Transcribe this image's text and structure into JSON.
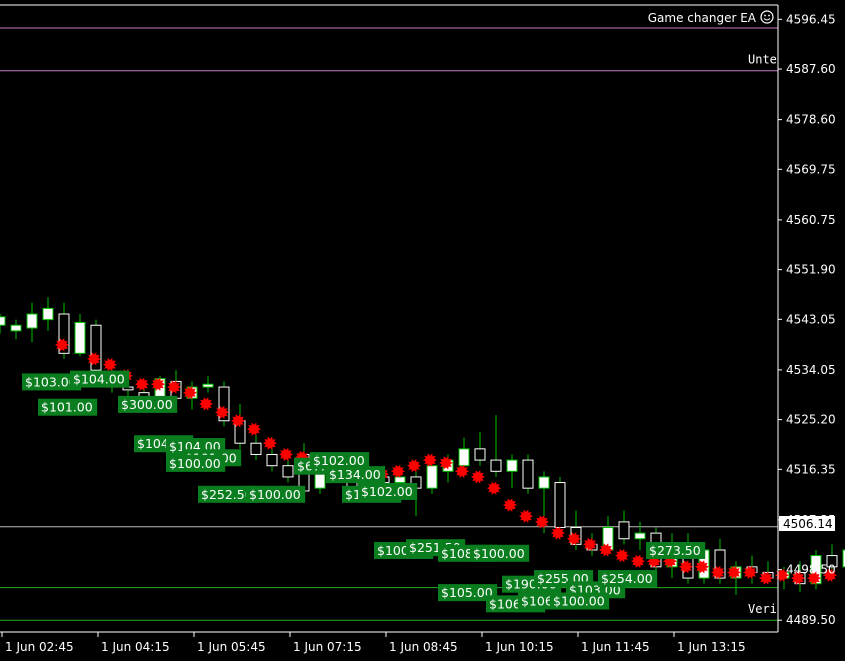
{
  "window": {
    "ea_label": "Game changer EA",
    "ea_icon": "smiley-icon"
  },
  "colors": {
    "background": "#000000",
    "bull_body": "#ffffff",
    "wick": "#00c000",
    "label_bg": "#0a7d1e",
    "label_text": "#ffffff",
    "marker": "#ff0000",
    "level_line": "#c878c8",
    "green_line": "#22aa22",
    "axis": "#ffffff"
  },
  "chart_data": {
    "type": "candlestick",
    "symbol_price": "4506.14",
    "y_ticks": [
      "4596.45",
      "4587.60",
      "4578.60",
      "4569.75",
      "4560.75",
      "4551.90",
      "4543.05",
      "4534.05",
      "4525.20",
      "4516.35",
      "4507.35",
      "4498.50",
      "4489.50"
    ],
    "x_ticks": [
      "1 Jun 02:45",
      "1 Jun 04:15",
      "1 Jun 05:45",
      "1 Jun 07:15",
      "1 Jun 08:45",
      "1 Jun 10:15",
      "1 Jun 11:45",
      "1 Jun 13:15"
    ],
    "ylim": [
      4487.4,
      4599.0
    ],
    "horizontal_lines": [
      {
        "price": 4594.9,
        "color": "#c878c8",
        "label": ""
      },
      {
        "price": 4587.3,
        "color": "#c878c8",
        "label": "Unte"
      },
      {
        "price": 4506.14,
        "color": "#bbbbbb",
        "label": ""
      },
      {
        "price": 4495.3,
        "color": "#22aa22",
        "label": ""
      },
      {
        "price": 4489.5,
        "color": "#22aa22",
        "label": "Veri"
      }
    ],
    "candles": [
      {
        "o": 4542.0,
        "h": 4544.0,
        "l": 4540.5,
        "c": 4543.5
      },
      {
        "o": 4541.0,
        "h": 4543.0,
        "l": 4539.5,
        "c": 4542.0
      },
      {
        "o": 4541.5,
        "h": 4546.0,
        "l": 4539.0,
        "c": 4544.0
      },
      {
        "o": 4543.0,
        "h": 4547.0,
        "l": 4541.0,
        "c": 4545.0
      },
      {
        "o": 4544.0,
        "h": 4546.0,
        "l": 4536.0,
        "c": 4537.0
      },
      {
        "o": 4537.0,
        "h": 4544.0,
        "l": 4536.5,
        "c": 4542.5
      },
      {
        "o": 4542.0,
        "h": 4543.0,
        "l": 4533.0,
        "c": 4534.0
      },
      {
        "o": 4533.5,
        "h": 4535.0,
        "l": 4530.0,
        "c": 4531.0
      },
      {
        "o": 4531.0,
        "h": 4534.0,
        "l": 4529.0,
        "c": 4530.5
      },
      {
        "o": 4530.0,
        "h": 4531.0,
        "l": 4527.5,
        "c": 4528.0
      },
      {
        "o": 4528.0,
        "h": 4533.0,
        "l": 4527.0,
        "c": 4532.5
      },
      {
        "o": 4532.0,
        "h": 4534.0,
        "l": 4528.0,
        "c": 4529.0
      },
      {
        "o": 4529.0,
        "h": 4532.0,
        "l": 4527.0,
        "c": 4531.0
      },
      {
        "o": 4531.0,
        "h": 4533.0,
        "l": 4530.0,
        "c": 4531.5
      },
      {
        "o": 4531.0,
        "h": 4532.0,
        "l": 4524.0,
        "c": 4525.0
      },
      {
        "o": 4525.0,
        "h": 4528.0,
        "l": 4520.0,
        "c": 4521.0
      },
      {
        "o": 4521.0,
        "h": 4523.0,
        "l": 4518.0,
        "c": 4519.0
      },
      {
        "o": 4519.0,
        "h": 4522.0,
        "l": 4516.0,
        "c": 4517.0
      },
      {
        "o": 4517.0,
        "h": 4519.0,
        "l": 4514.0,
        "c": 4515.0
      },
      {
        "o": 4519.0,
        "h": 4521.0,
        "l": 4511.0,
        "c": 4512.5
      },
      {
        "o": 4513.0,
        "h": 4518.0,
        "l": 4512.0,
        "c": 4517.0
      },
      {
        "o": 4517.0,
        "h": 4518.0,
        "l": 4514.0,
        "c": 4515.0
      },
      {
        "o": 4515.0,
        "h": 4516.0,
        "l": 4511.0,
        "c": 4512.0
      },
      {
        "o": 4513.0,
        "h": 4516.0,
        "l": 4512.0,
        "c": 4515.0
      },
      {
        "o": 4515.0,
        "h": 4517.0,
        "l": 4513.0,
        "c": 4514.0
      },
      {
        "o": 4514.0,
        "h": 4516.0,
        "l": 4512.5,
        "c": 4515.0
      },
      {
        "o": 4515.0,
        "h": 4517.0,
        "l": 4508.0,
        "c": 4513.0
      },
      {
        "o": 4513.0,
        "h": 4518.0,
        "l": 4512.0,
        "c": 4517.0
      },
      {
        "o": 4516.0,
        "h": 4519.0,
        "l": 4514.0,
        "c": 4518.0
      },
      {
        "o": 4517.0,
        "h": 4522.0,
        "l": 4515.0,
        "c": 4520.0
      },
      {
        "o": 4520.0,
        "h": 4523.0,
        "l": 4517.0,
        "c": 4518.0
      },
      {
        "o": 4518.0,
        "h": 4526.0,
        "l": 4515.0,
        "c": 4516.0
      },
      {
        "o": 4516.0,
        "h": 4519.0,
        "l": 4513.0,
        "c": 4518.0
      },
      {
        "o": 4518.0,
        "h": 4519.0,
        "l": 4512.0,
        "c": 4513.0
      },
      {
        "o": 4513.0,
        "h": 4516.0,
        "l": 4505.0,
        "c": 4515.0
      },
      {
        "o": 4514.0,
        "h": 4515.0,
        "l": 4505.0,
        "c": 4506.0
      },
      {
        "o": 4506.0,
        "h": 4509.0,
        "l": 4502.0,
        "c": 4503.0
      },
      {
        "o": 4503.0,
        "h": 4505.0,
        "l": 4501.0,
        "c": 4502.0
      },
      {
        "o": 4502.0,
        "h": 4508.0,
        "l": 4501.0,
        "c": 4506.0
      },
      {
        "o": 4507.0,
        "h": 4509.0,
        "l": 4503.0,
        "c": 4504.0
      },
      {
        "o": 4504.0,
        "h": 4507.0,
        "l": 4502.0,
        "c": 4505.0
      },
      {
        "o": 4505.0,
        "h": 4506.0,
        "l": 4498.0,
        "c": 4499.0
      },
      {
        "o": 4499.0,
        "h": 4505.0,
        "l": 4497.0,
        "c": 4503.0
      },
      {
        "o": 4503.0,
        "h": 4505.0,
        "l": 4496.0,
        "c": 4497.0
      },
      {
        "o": 4497.0,
        "h": 4503.0,
        "l": 4496.0,
        "c": 4502.0
      },
      {
        "o": 4502.0,
        "h": 4504.0,
        "l": 4496.0,
        "c": 4497.0
      },
      {
        "o": 4497.0,
        "h": 4500.0,
        "l": 4494.0,
        "c": 4499.0
      },
      {
        "o": 4499.0,
        "h": 4501.0,
        "l": 4496.0,
        "c": 4498.0
      },
      {
        "o": 4498.0,
        "h": 4500.0,
        "l": 4496.0,
        "c": 4497.0
      },
      {
        "o": 4497.0,
        "h": 4499.0,
        "l": 4495.0,
        "c": 4498.0
      },
      {
        "o": 4498.0,
        "h": 4500.0,
        "l": 4494.5,
        "c": 4496.0
      },
      {
        "o": 4496.0,
        "h": 4502.0,
        "l": 4495.0,
        "c": 4501.0
      },
      {
        "o": 4501.0,
        "h": 4503.0,
        "l": 4497.0,
        "c": 4499.0
      },
      {
        "o": 4499.0,
        "h": 4508.0,
        "l": 4496.0,
        "c": 4502.0
      },
      {
        "o": 4498.0,
        "h": 4500.0,
        "l": 4489.5,
        "c": 4499.0
      },
      {
        "o": 4499.0,
        "h": 4500.0,
        "l": 4497.0,
        "c": 4499.5
      },
      {
        "o": 4499.5,
        "h": 4502.0,
        "l": 4498.0,
        "c": 4501.0
      },
      {
        "o": 4500.0,
        "h": 4503.0,
        "l": 4499.0,
        "c": 4502.0
      },
      {
        "o": 4502.0,
        "h": 4504.0,
        "l": 4500.0,
        "c": 4503.0
      },
      {
        "o": 4501.0,
        "h": 4507.0,
        "l": 4500.0,
        "c": 4506.0
      },
      {
        "o": 4505.0,
        "h": 4508.0,
        "l": 4503.0,
        "c": 4507.0
      },
      {
        "o": 4504.0,
        "h": 4511.0,
        "l": 4502.0,
        "c": 4506.0
      },
      {
        "o": 4502.0,
        "h": 4506.0,
        "l": 4501.0,
        "c": 4505.0
      },
      {
        "o": 4505.0,
        "h": 4507.0,
        "l": 4503.0,
        "c": 4506.0
      },
      {
        "o": 4506.0,
        "h": 4508.0,
        "l": 4505.0,
        "c": 4507.0
      },
      {
        "o": 4506.0,
        "h": 4507.0,
        "l": 4505.0,
        "c": 4506.5
      }
    ],
    "markers": [
      [
        4538.5,
        4
      ],
      [
        4536.0,
        6
      ],
      [
        4535.0,
        7
      ],
      [
        4533.0,
        8
      ],
      [
        4531.5,
        9
      ],
      [
        4531.5,
        10
      ],
      [
        4531.0,
        11
      ],
      [
        4530.0,
        12
      ],
      [
        4528.0,
        13
      ],
      [
        4526.5,
        14
      ],
      [
        4525.0,
        15
      ],
      [
        4523.5,
        16
      ],
      [
        4521.0,
        17
      ],
      [
        4519.0,
        18
      ],
      [
        4518.5,
        19
      ],
      [
        4517.0,
        20
      ],
      [
        4516.5,
        21
      ],
      [
        4516.0,
        22
      ],
      [
        4515.5,
        23
      ],
      [
        4515.5,
        24
      ],
      [
        4516.0,
        25
      ],
      [
        4517.0,
        26
      ],
      [
        4518.0,
        27
      ],
      [
        4517.5,
        28
      ],
      [
        4516.0,
        29
      ],
      [
        4515.0,
        30
      ],
      [
        4513.0,
        31
      ],
      [
        4510.0,
        32
      ],
      [
        4508.0,
        33
      ],
      [
        4507.0,
        34
      ],
      [
        4505.0,
        35
      ],
      [
        4504.0,
        36
      ],
      [
        4503.0,
        37
      ],
      [
        4502.0,
        38
      ],
      [
        4501.0,
        39
      ],
      [
        4500.0,
        40
      ],
      [
        4500.0,
        41
      ],
      [
        4500.0,
        42
      ],
      [
        4499.0,
        43
      ],
      [
        4499.0,
        44
      ],
      [
        4498.0,
        45
      ],
      [
        4498.0,
        46
      ],
      [
        4498.0,
        47
      ],
      [
        4497.0,
        48
      ],
      [
        4497.5,
        49
      ],
      [
        4497.0,
        50
      ],
      [
        4497.0,
        51
      ],
      [
        4497.5,
        52
      ]
    ],
    "trade_labels": [
      {
        "text": "$103.00",
        "price": 4532.0,
        "candle": 2
      },
      {
        "text": "$104.00",
        "price": 4532.5,
        "candle": 5
      },
      {
        "text": "$101.00",
        "price": 4527.5,
        "candle": 3
      },
      {
        "text": "$300.00",
        "price": 4528.0,
        "candle": 8
      },
      {
        "text": "$104.00",
        "price": 4521.0,
        "candle": 9
      },
      {
        "text": "$104.00",
        "price": 4520.5,
        "candle": 11
      },
      {
        "text": "$101.00",
        "price": 4518.5,
        "candle": 12
      },
      {
        "text": "$100.00",
        "price": 4517.5,
        "candle": 11
      },
      {
        "text": "$252.50",
        "price": 4512.0,
        "candle": 13
      },
      {
        "text": "$100.00",
        "price": 4512.0,
        "candle": 16
      },
      {
        "text": "$67.00",
        "price": 4517.0,
        "candle": 19
      },
      {
        "text": "$102.00",
        "price": 4518.0,
        "candle": 20
      },
      {
        "text": "$134.00",
        "price": 4515.5,
        "candle": 21
      },
      {
        "text": "$102.00",
        "price": 4512.0,
        "candle": 22
      },
      {
        "text": "$102.00",
        "price": 4512.5,
        "candle": 23
      },
      {
        "text": "$100.00",
        "price": 4502.0,
        "candle": 24
      },
      {
        "text": "$251.50",
        "price": 4502.5,
        "candle": 26
      },
      {
        "text": "$108.00",
        "price": 4501.5,
        "candle": 28
      },
      {
        "text": "$100.00",
        "price": 4501.5,
        "candle": 30
      },
      {
        "text": "$105.00",
        "price": 4494.5,
        "candle": 28
      },
      {
        "text": "$190.00",
        "price": 4496.0,
        "candle": 32
      },
      {
        "text": "$106.00",
        "price": 4492.5,
        "candle": 31
      },
      {
        "text": "$106.00",
        "price": 4493.0,
        "candle": 33
      },
      {
        "text": "$255.00",
        "price": 4497.0,
        "candle": 34
      },
      {
        "text": "$103.00",
        "price": 4495.0,
        "candle": 36
      },
      {
        "text": "$100.00",
        "price": 4493.0,
        "candle": 35
      },
      {
        "text": "$254.00",
        "price": 4497.0,
        "candle": 38
      },
      {
        "text": "$273.50",
        "price": 4502.0,
        "candle": 41
      }
    ]
  }
}
